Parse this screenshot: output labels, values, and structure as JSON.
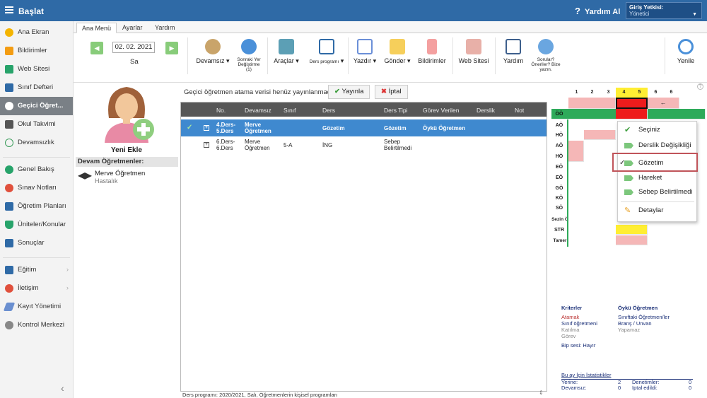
{
  "topbar": {
    "title": "Başlat",
    "help_label": "Yardım Al",
    "auth_label": "Giriş Yetkisi:",
    "auth_value": "Yönetici"
  },
  "sidebar": {
    "items": [
      {
        "label": "Ana Ekran"
      },
      {
        "label": "Bildirimler"
      },
      {
        "label": "Web Sitesi"
      },
      {
        "label": "Sınıf Defteri"
      },
      {
        "label": "Geçici Öğret..."
      },
      {
        "label": "Okul Takvimi"
      },
      {
        "label": "Devamsızlık"
      },
      {
        "label": "Genel Bakış"
      },
      {
        "label": "Sınav Notları"
      },
      {
        "label": "Öğretim Planları"
      },
      {
        "label": "Üniteler/Konular"
      },
      {
        "label": "Sonuçlar"
      },
      {
        "label": "Eğitim"
      },
      {
        "label": "İletişim"
      },
      {
        "label": "Kayıt Yönetimi"
      },
      {
        "label": "Kontrol Merkezi"
      }
    ]
  },
  "tabs": [
    "Ana Menü",
    "Ayarlar",
    "Yardım"
  ],
  "ribbon": {
    "date": "02. 02. 2021",
    "day": "Sa",
    "devamsiz": "Devamsız",
    "sonraki": "Sonraki Yer Değiştirme (1)",
    "araclar": "Araçlar",
    "ders_programi": "Ders programı",
    "yazdir": "Yazdır",
    "gonder": "Gönder",
    "bildirimler": "Bildirimler",
    "web_sitesi": "Web Sitesi",
    "yardim": "Yardım",
    "sorular": "Sorular? Öneriler? Bize yazın.",
    "yenile": "Yenile"
  },
  "left": {
    "yeni_ekle": "Yeni Ekle",
    "devam_header": "Devam Öğretmenler:",
    "teacher_name": "Merve Öğretmen",
    "teacher_status": "Hastalık"
  },
  "main": {
    "message": "Geçici öğretmen atama verisi henüz yayınlanmadı.",
    "publish": "Yayınla",
    "cancel": "İptal",
    "columns": [
      "No.",
      "Devamsız",
      "Sınıf",
      "Ders",
      "Ders Tipi",
      "Görev Verilen",
      "Derslik",
      "Not"
    ],
    "rows": [
      {
        "no": "4.Ders- 5.Ders",
        "devamsiz": "Merve Öğretmen",
        "sinif": "",
        "ders": "Gözetim",
        "tip": "Gözetim",
        "gorev": "Öykü Öğretmen"
      },
      {
        "no": "6.Ders- 6.Ders",
        "devamsiz": "Merve Öğretmen",
        "sinif": "5-A",
        "ders": "İNG",
        "tip": "Sebep Belirtilmedi",
        "gorev": ""
      }
    ],
    "footer": "Ders programı: 2020/2021, Salı, Öğretmenlerin kişisel programları"
  },
  "schedule": {
    "columns": [
      "1",
      "2",
      "3",
      "4",
      "5",
      "6",
      "6"
    ],
    "arrow": "←",
    "rows": [
      "ÖÖ",
      "AÖ",
      "HÖ",
      "AÖ",
      "HÖ",
      "EÖ",
      "EÖ",
      "GÖ",
      "KÖ",
      "SÖ",
      "Sezin Ö",
      "STR",
      "Tamer"
    ]
  },
  "context_menu": {
    "items": [
      "Seçiniz",
      "Derslik Değişikliği",
      "Gözetim",
      "Hareket",
      "Sebep Belirtilmedi",
      "Detaylar"
    ]
  },
  "criteria": {
    "title": "Kriterler",
    "teacher": "Öykü Öğretmen",
    "left": [
      "Atamak",
      "Sınıf öğretmeni",
      "Katılma",
      "Görev"
    ],
    "right": [
      "Sınıftaki Öğretmen/ler",
      "Branş / Unvan",
      "Yapamaz"
    ],
    "bip": "Bip sesi: Hayır"
  },
  "stats": {
    "title": "Bu ay İçin İstatistikler",
    "yerine": "Yerine:",
    "yerine_v": "2",
    "denetimler": "Denetimler:",
    "denetimler_v": "0",
    "devamsiz": "Devamsız:",
    "devamsiz_v": "0",
    "iptal": "İptal edildi:",
    "iptal_v": "0"
  }
}
